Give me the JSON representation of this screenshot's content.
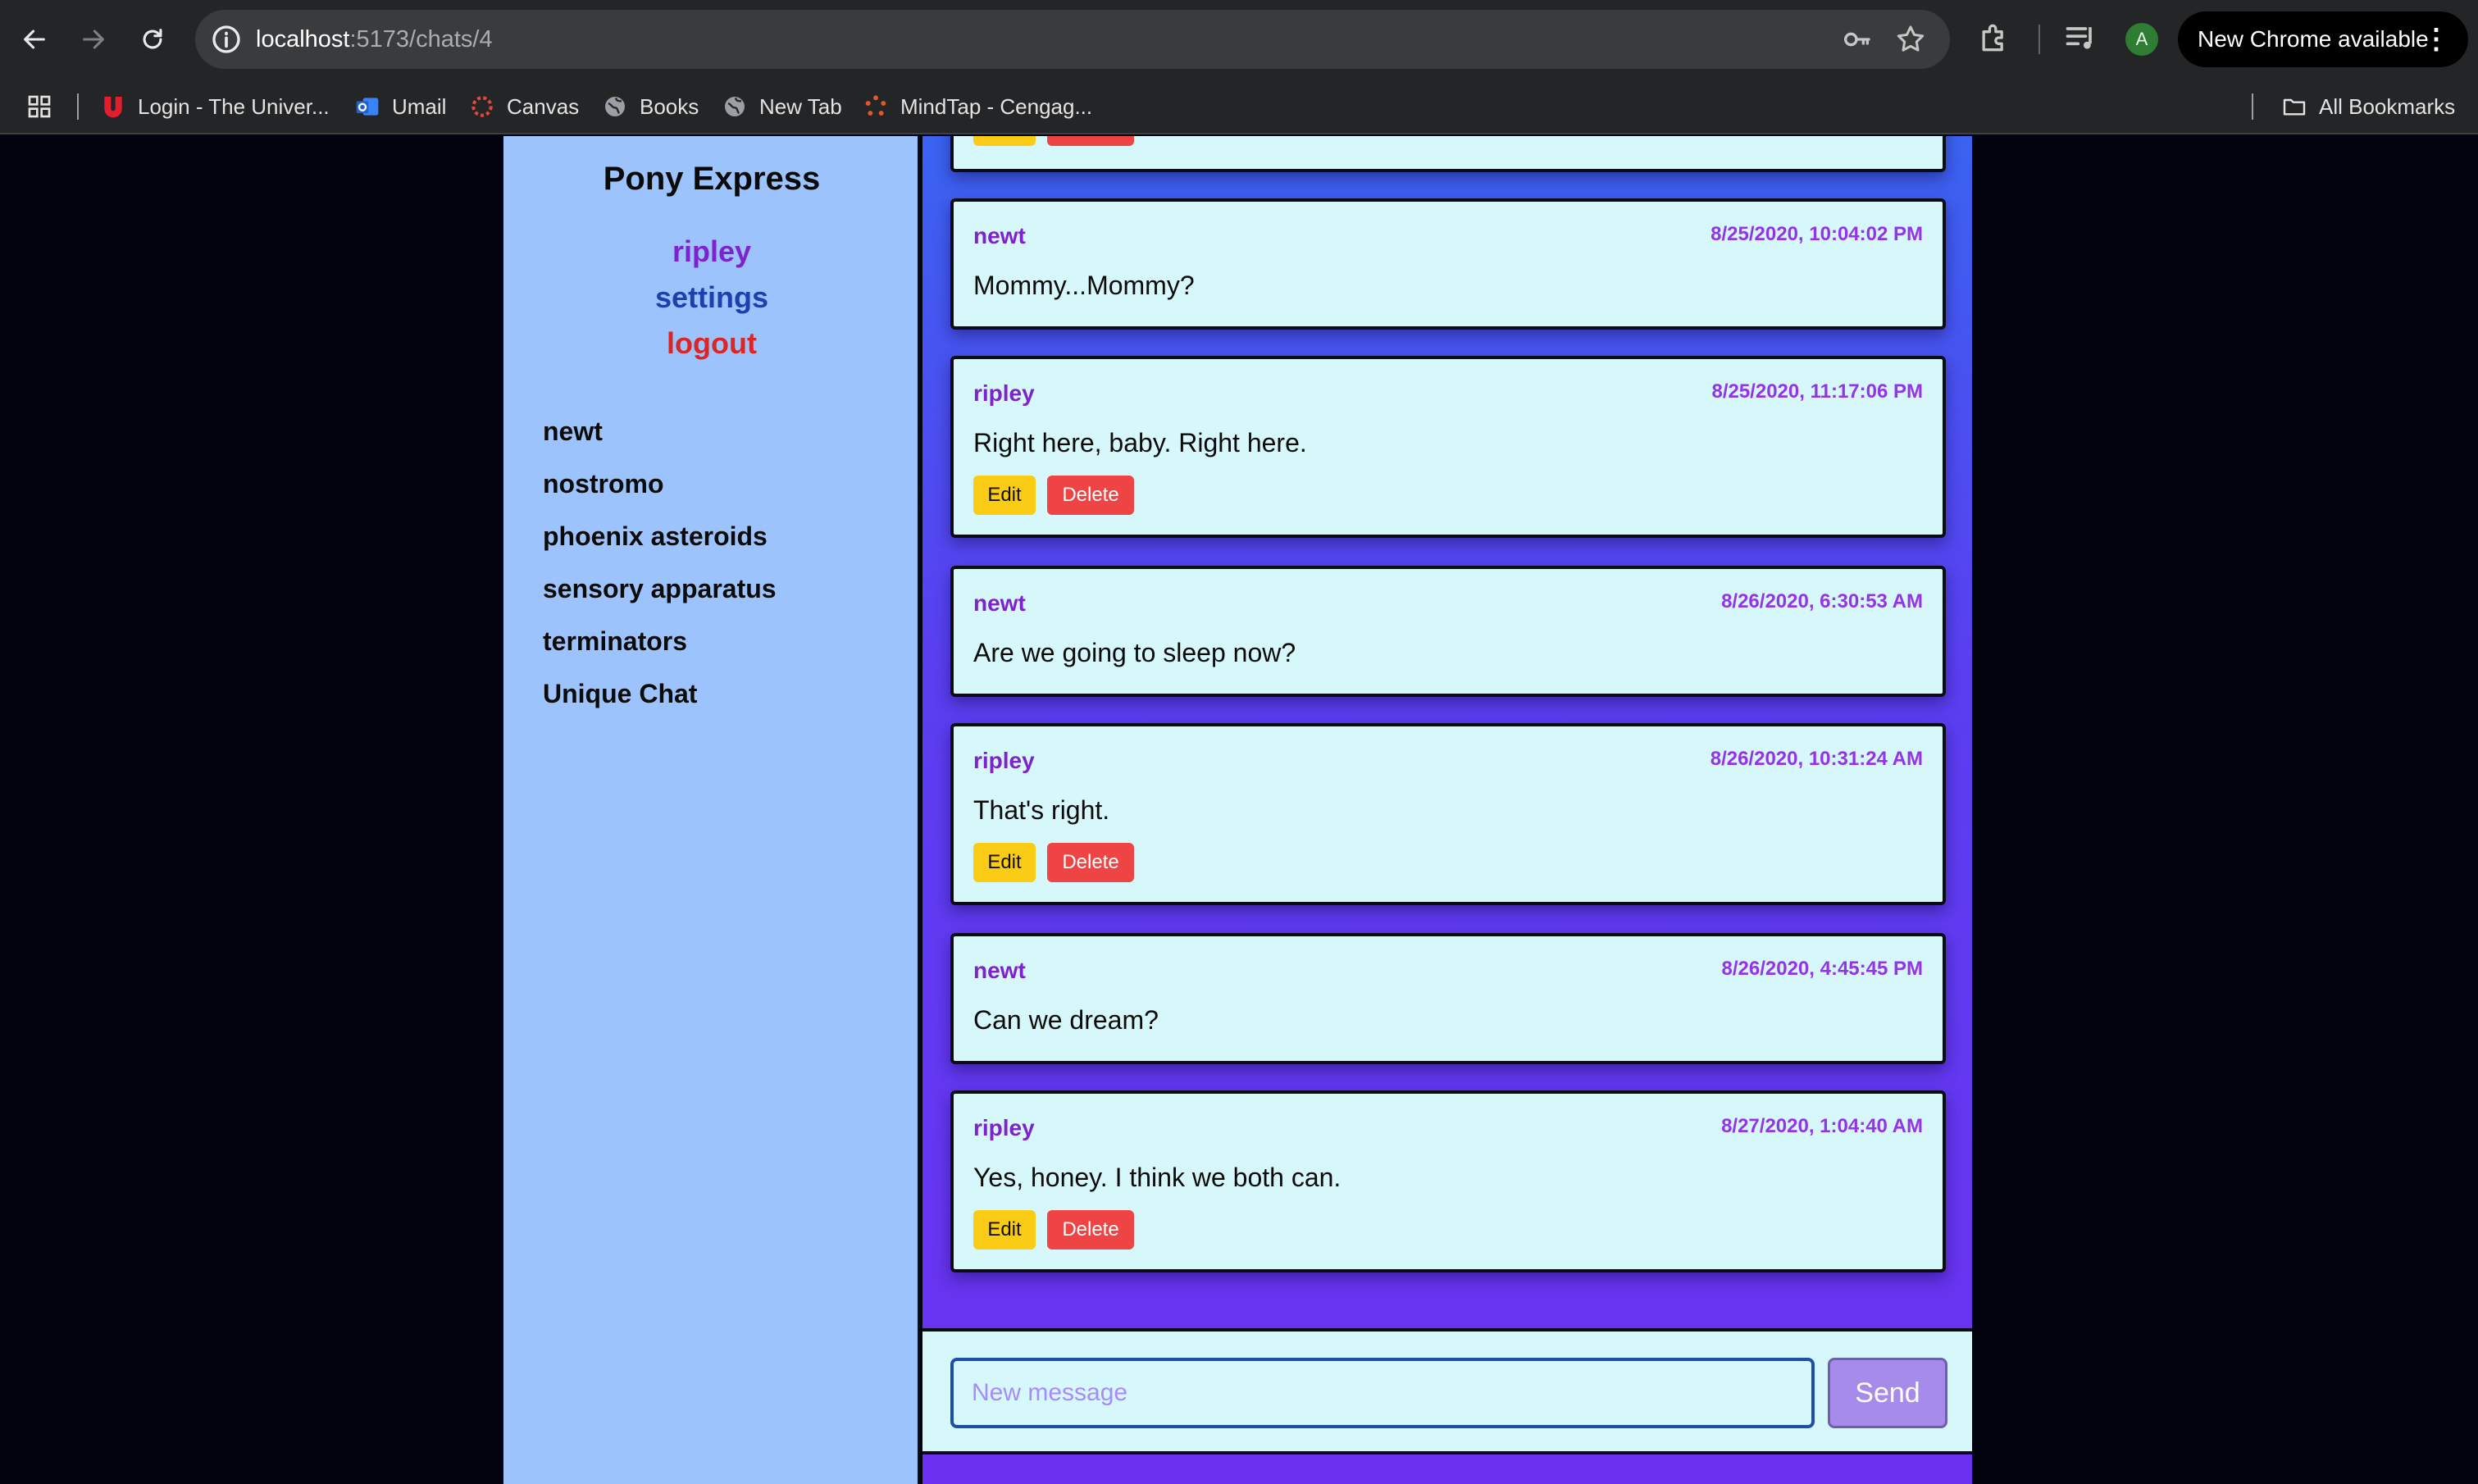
{
  "browser": {
    "url_host": "localhost",
    "url_path": ":5173/chats/4",
    "profile_initial": "A",
    "update_label": "New Chrome available",
    "bookmarks": [
      {
        "label": "Login - The Univer..."
      },
      {
        "label": "Umail"
      },
      {
        "label": "Canvas"
      },
      {
        "label": "Books"
      },
      {
        "label": "New Tab"
      },
      {
        "label": "MindTap - Cengag..."
      }
    ],
    "all_bookmarks": "All Bookmarks"
  },
  "app": {
    "title": "Pony Express",
    "user": "ripley",
    "settings": "settings",
    "logout": "logout",
    "chats": [
      "newt",
      "nostromo",
      "phoenix asteroids",
      "sensory apparatus",
      "terminators",
      "Unique Chat"
    ]
  },
  "partial_message": {
    "edit": "Edit",
    "delete": "Delete"
  },
  "messages": [
    {
      "author": "newt",
      "time": "8/25/2020, 10:04:02 PM",
      "text": "Mommy...Mommy?"
    },
    {
      "author": "ripley",
      "time": "8/25/2020, 11:17:06 PM",
      "text": "Right here, baby. Right here.",
      "edit": "Edit",
      "delete": "Delete"
    },
    {
      "author": "newt",
      "time": "8/26/2020, 6:30:53 AM",
      "text": "Are we going to sleep now?"
    },
    {
      "author": "ripley",
      "time": "8/26/2020, 10:31:24 AM",
      "text": "That's right.",
      "edit": "Edit",
      "delete": "Delete"
    },
    {
      "author": "newt",
      "time": "8/26/2020, 4:45:45 PM",
      "text": "Can we dream?"
    },
    {
      "author": "ripley",
      "time": "8/27/2020, 1:04:40 AM",
      "text": "Yes, honey. I think we both can.",
      "edit": "Edit",
      "delete": "Delete"
    }
  ],
  "composer": {
    "placeholder": "New message",
    "send": "Send"
  }
}
